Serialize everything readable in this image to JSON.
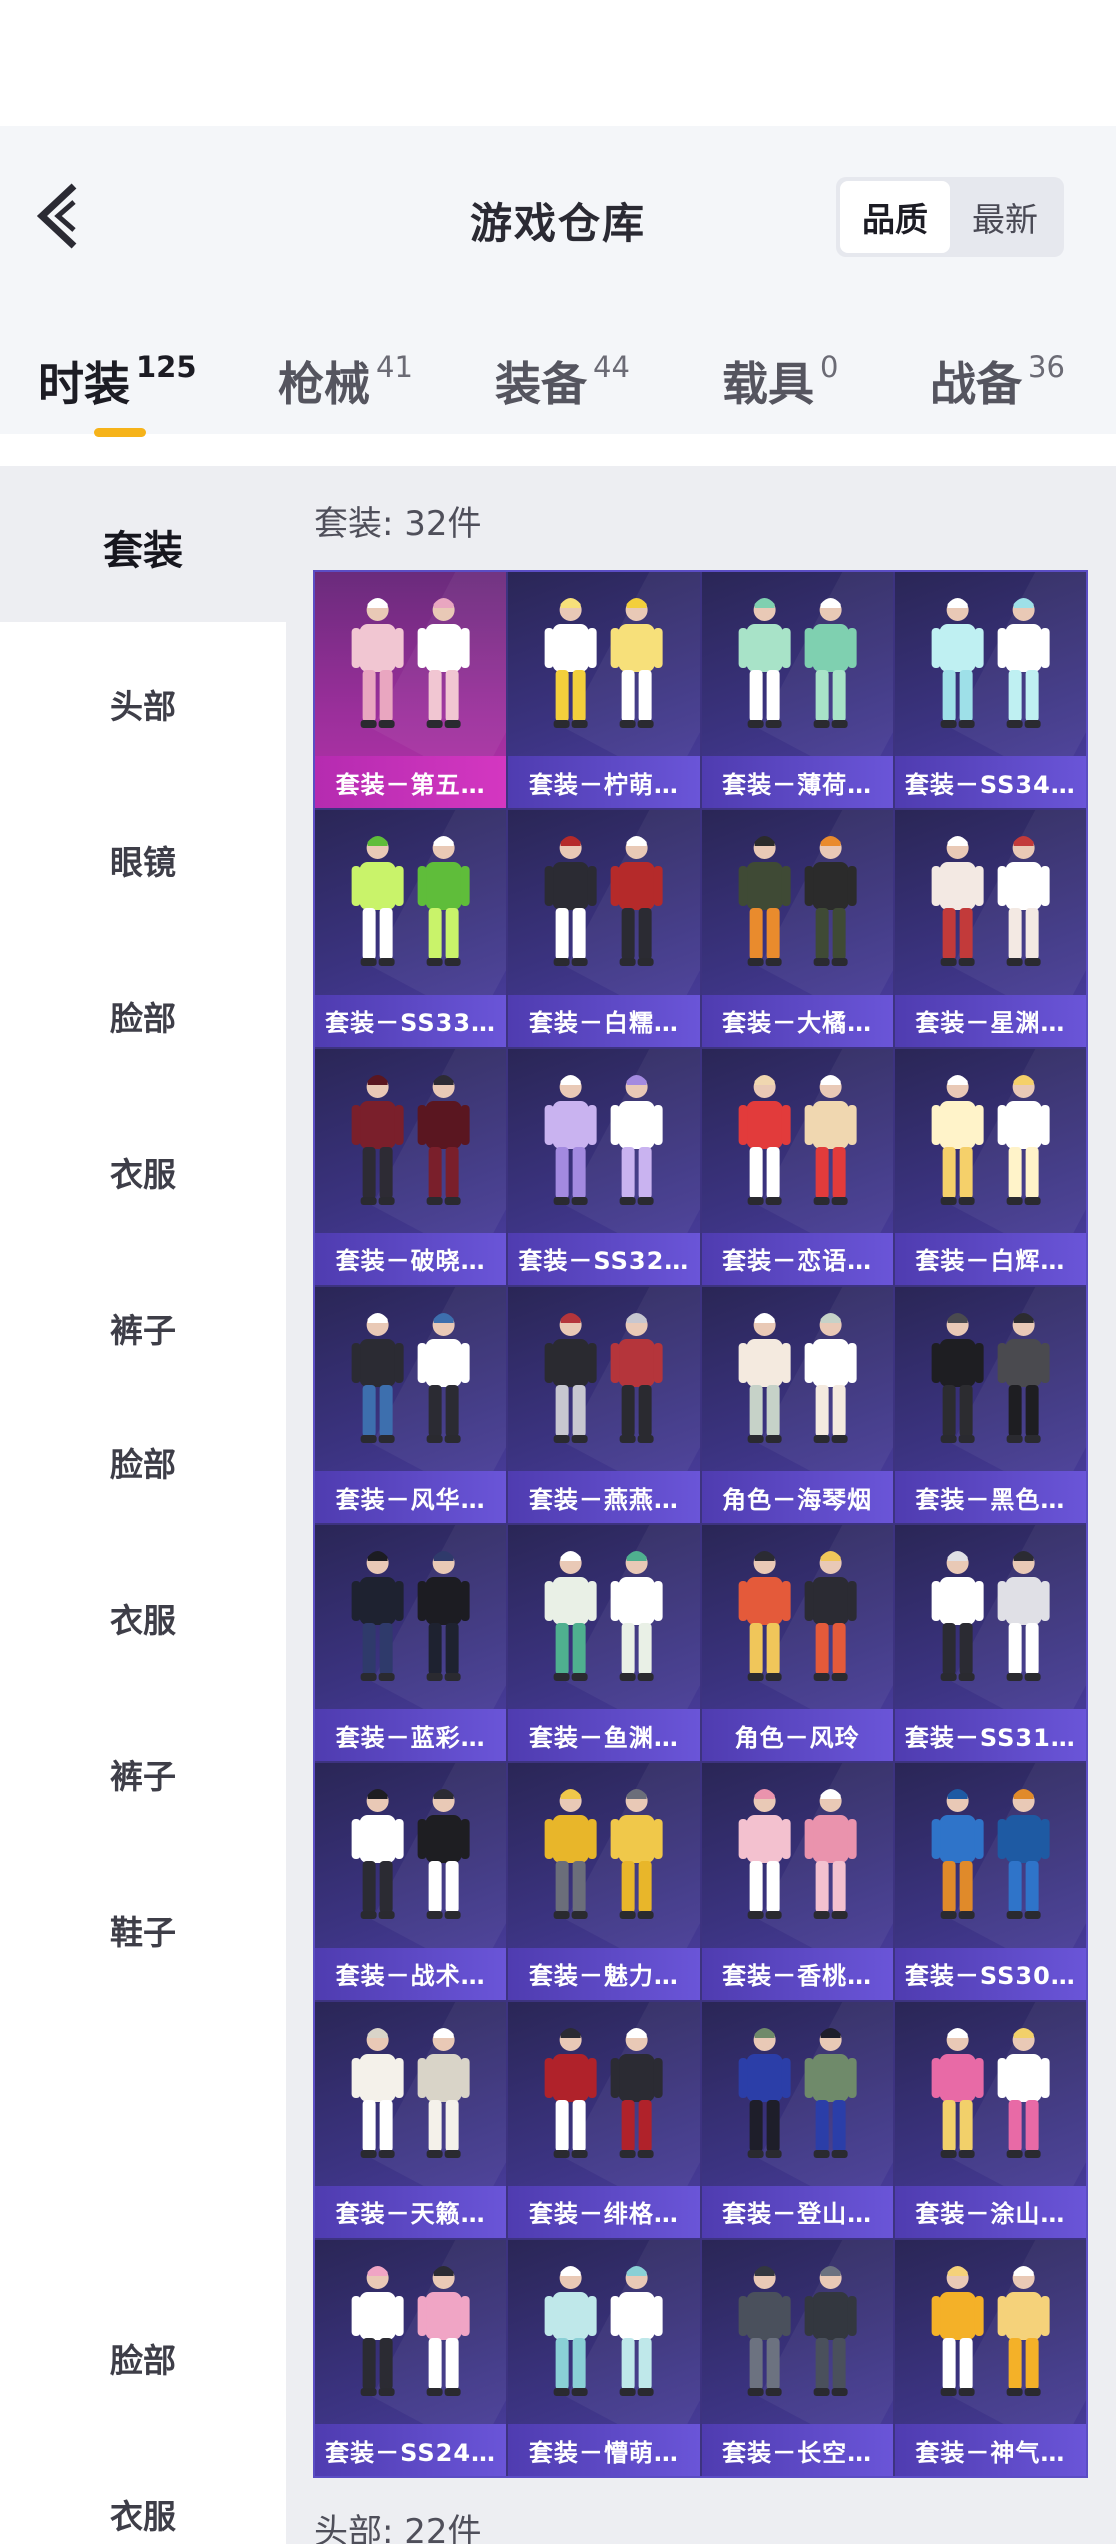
{
  "header": {
    "title": "游戏仓库",
    "sort_options": [
      {
        "label": "品质",
        "active": true
      },
      {
        "label": "最新",
        "active": false
      }
    ]
  },
  "tabs": [
    {
      "label": "时装",
      "count": "125",
      "active": true
    },
    {
      "label": "枪械",
      "count": "41",
      "active": false
    },
    {
      "label": "装备",
      "count": "44",
      "active": false
    },
    {
      "label": "载具",
      "count": "0",
      "active": false
    },
    {
      "label": "战备",
      "count": "36",
      "active": false
    }
  ],
  "sidebar": {
    "items": [
      {
        "label": "套装",
        "active": true
      },
      {
        "label": "头部"
      },
      {
        "label": "眼镜"
      },
      {
        "label": "脸部"
      },
      {
        "label": "衣服"
      },
      {
        "label": "裤子"
      },
      {
        "label": "脸部"
      },
      {
        "label": "衣服"
      },
      {
        "label": "裤子"
      },
      {
        "label": "鞋子"
      },
      {
        "label": "脸部"
      },
      {
        "label": "衣服"
      }
    ]
  },
  "content": {
    "section_title": "套装: 32件",
    "next_section_title": "头部: 22件",
    "items": [
      {
        "label": "套装－第五…",
        "highlight": true,
        "palette": [
          "#f1c6d2",
          "#e9a6c0",
          "#ffffff"
        ]
      },
      {
        "label": "套装－柠萌…",
        "palette": [
          "#ffffff",
          "#f3cf3c",
          "#f7e07a"
        ]
      },
      {
        "label": "套装－薄荷…",
        "palette": [
          "#a8e3c8",
          "#ffffff",
          "#7fd0b0"
        ]
      },
      {
        "label": "套装－SS34…",
        "palette": [
          "#bff0f2",
          "#9ee0e8",
          "#ffffff"
        ]
      },
      {
        "label": "套装－SS33…",
        "palette": [
          "#c9f36a",
          "#ffffff",
          "#5fbd3a"
        ]
      },
      {
        "label": "套装－白糯…",
        "palette": [
          "#2b2b33",
          "#ffffff",
          "#b52a2a"
        ]
      },
      {
        "label": "套装－大橘…",
        "palette": [
          "#3f4a35",
          "#e98b2d",
          "#2b2b2b"
        ]
      },
      {
        "label": "套装－星渊…",
        "palette": [
          "#f3e9e3",
          "#c23a3a",
          "#ffffff"
        ]
      },
      {
        "label": "套装－破晓…",
        "palette": [
          "#7a1f2b",
          "#2d2b34",
          "#5a1620"
        ]
      },
      {
        "label": "套装－SS32…",
        "palette": [
          "#c9b3f0",
          "#a38ae0",
          "#ffffff"
        ]
      },
      {
        "label": "套装－恋语…",
        "palette": [
          "#e23b3b",
          "#ffffff",
          "#f0d7b0"
        ]
      },
      {
        "label": "套装－白辉…",
        "palette": [
          "#fff3c9",
          "#f5d06a",
          "#ffffff"
        ]
      },
      {
        "label": "套装－风华…",
        "palette": [
          "#2b2b33",
          "#3d6fae",
          "#ffffff"
        ]
      },
      {
        "label": "套装－燕燕…",
        "palette": [
          "#2a2a30",
          "#c7c7d0",
          "#b5353b"
        ]
      },
      {
        "label": "角色－海琴烟",
        "palette": [
          "#f4eadf",
          "#c6d2c8",
          "#ffffff"
        ]
      },
      {
        "label": "套装－黑色…",
        "palette": [
          "#1e1e22",
          "#2c2c30",
          "#4a4a4f"
        ]
      },
      {
        "label": "套装－蓝彩…",
        "palette": [
          "#1e2230",
          "#2f3a6b",
          "#1c1c22"
        ]
      },
      {
        "label": "套装－鱼渊…",
        "palette": [
          "#e9f0e6",
          "#4fb08f",
          "#ffffff"
        ]
      },
      {
        "label": "角色－风玲",
        "palette": [
          "#e45a3a",
          "#f0c65a",
          "#2b2b33"
        ]
      },
      {
        "label": "套装－SS31…",
        "palette": [
          "#ffffff",
          "#2b2b33",
          "#e0e0e6"
        ]
      },
      {
        "label": "套装－战术…",
        "palette": [
          "#ffffff",
          "#2b2b33",
          "#1e1e22"
        ]
      },
      {
        "label": "套装－魅力…",
        "palette": [
          "#e8b62a",
          "#6b6e7a",
          "#f0c84a"
        ]
      },
      {
        "label": "套装－香桃…",
        "palette": [
          "#f3c1cf",
          "#ffffff",
          "#ea93ad"
        ]
      },
      {
        "label": "套装－SS30…",
        "palette": [
          "#2f74c9",
          "#e08a2a",
          "#1e5aa3"
        ]
      },
      {
        "label": "套装－天籁…",
        "palette": [
          "#f4f1ea",
          "#ffffff",
          "#d9d4c8"
        ]
      },
      {
        "label": "套装－绯格…",
        "palette": [
          "#b0222a",
          "#ffffff",
          "#2b2b33"
        ]
      },
      {
        "label": "套装－登山…",
        "palette": [
          "#2b3ea8",
          "#1e1e2a",
          "#6f8a6a"
        ]
      },
      {
        "label": "套装－涂山…",
        "palette": [
          "#e86aa6",
          "#f2d06a",
          "#ffffff"
        ]
      },
      {
        "label": "套装－SS24…",
        "palette": [
          "#ffffff",
          "#2b2b33",
          "#f0a5c5"
        ]
      },
      {
        "label": "套装－懵萌…",
        "palette": [
          "#bfe8ea",
          "#8ad0d6",
          "#ffffff"
        ]
      },
      {
        "label": "套装－长空…",
        "palette": [
          "#4a505c",
          "#6c7280",
          "#33373f"
        ]
      },
      {
        "label": "套装－神气…",
        "palette": [
          "#f4b128",
          "#ffffff",
          "#f5d27a"
        ]
      }
    ]
  },
  "colors": {
    "accent": "#f6b31a",
    "grid_border": "#5b4dc4",
    "label_bg": "#6a55d8",
    "highlight_label_bg": "#d437c1"
  }
}
